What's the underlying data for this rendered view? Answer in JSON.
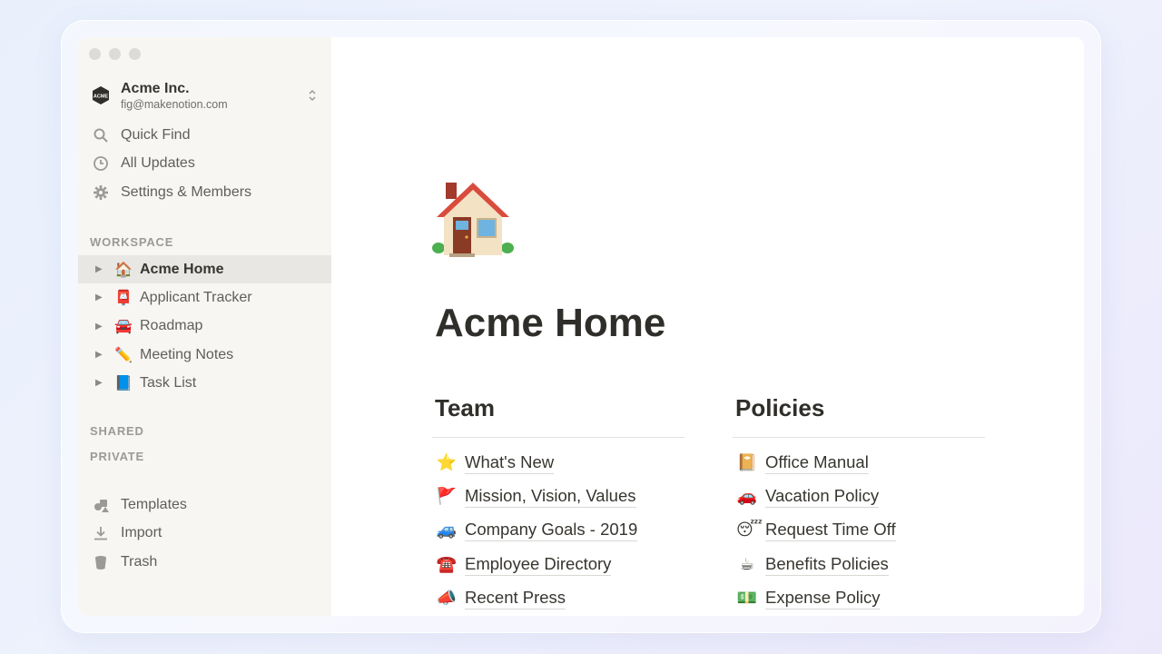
{
  "workspace": {
    "name": "Acme Inc.",
    "email": "fig@makenotion.com",
    "logo_text": "ACME"
  },
  "nav": [
    {
      "label": "Quick Find",
      "icon": "search-icon"
    },
    {
      "label": "All Updates",
      "icon": "clock-icon"
    },
    {
      "label": "Settings & Members",
      "icon": "gear-icon"
    }
  ],
  "sections": {
    "workspace": "WORKSPACE",
    "shared": "SHARED",
    "private": "PRIVATE"
  },
  "pages": [
    {
      "emoji": "🏠",
      "label": "Acme Home",
      "active": true
    },
    {
      "emoji": "📮",
      "label": "Applicant Tracker",
      "active": false
    },
    {
      "emoji": "🚘",
      "label": "Roadmap",
      "active": false
    },
    {
      "emoji": "✏️",
      "label": "Meeting Notes",
      "active": false
    },
    {
      "emoji": "📘",
      "label": "Task List",
      "active": false
    }
  ],
  "bottom_nav": [
    {
      "label": "Templates",
      "icon": "templates-icon"
    },
    {
      "label": "Import",
      "icon": "import-icon"
    },
    {
      "label": "Trash",
      "icon": "trash-icon"
    }
  ],
  "page": {
    "title": "Acme Home",
    "icon": "house-icon",
    "columns": [
      {
        "heading": "Team",
        "links": [
          {
            "emoji": "⭐",
            "label": "What's New"
          },
          {
            "emoji": "🚩",
            "label": "Mission, Vision, Values"
          },
          {
            "emoji": "🚙",
            "label": "Company Goals - 2019"
          },
          {
            "emoji": "☎️",
            "label": "Employee Directory"
          },
          {
            "emoji": "📣",
            "label": "Recent Press"
          }
        ]
      },
      {
        "heading": "Policies",
        "links": [
          {
            "emoji": "📔",
            "label": "Office Manual"
          },
          {
            "emoji": "🚗",
            "label": "Vacation Policy"
          },
          {
            "emoji": "😴",
            "label": "Request Time Off"
          },
          {
            "emoji": "☕",
            "label": "Benefits Policies"
          },
          {
            "emoji": "💵",
            "label": "Expense Policy"
          }
        ]
      }
    ]
  }
}
